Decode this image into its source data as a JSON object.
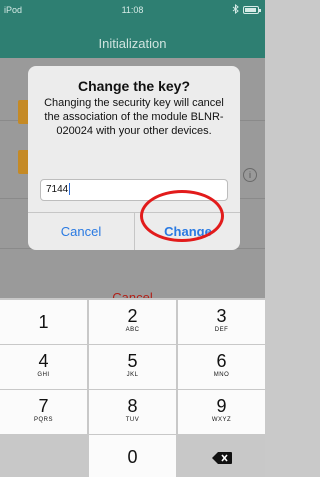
{
  "status": {
    "carrier": "iPod",
    "time": "11:08"
  },
  "nav": {
    "title": "Initialization"
  },
  "background": {
    "cancel_label": "Cancel"
  },
  "dialog": {
    "title": "Change the key?",
    "message": "Changing the security key will cancel the association of the module BLNR-020024 with your other devices.",
    "input_value": "7144",
    "cancel_label": "Cancel",
    "change_label": "Change"
  },
  "keypad": {
    "keys": [
      {
        "digit": "1",
        "letters": ""
      },
      {
        "digit": "2",
        "letters": "ABC"
      },
      {
        "digit": "3",
        "letters": "DEF"
      },
      {
        "digit": "4",
        "letters": "GHI"
      },
      {
        "digit": "5",
        "letters": "JKL"
      },
      {
        "digit": "6",
        "letters": "MNO"
      },
      {
        "digit": "7",
        "letters": "PQRS"
      },
      {
        "digit": "8",
        "letters": "TUV"
      },
      {
        "digit": "9",
        "letters": "WXYZ"
      },
      {
        "digit": "0",
        "letters": ""
      }
    ]
  },
  "colors": {
    "nav_bg": "#2e7f72",
    "accent": "#2a7ae2",
    "destructive": "#b01f17",
    "highlight": "#e21b1b"
  }
}
